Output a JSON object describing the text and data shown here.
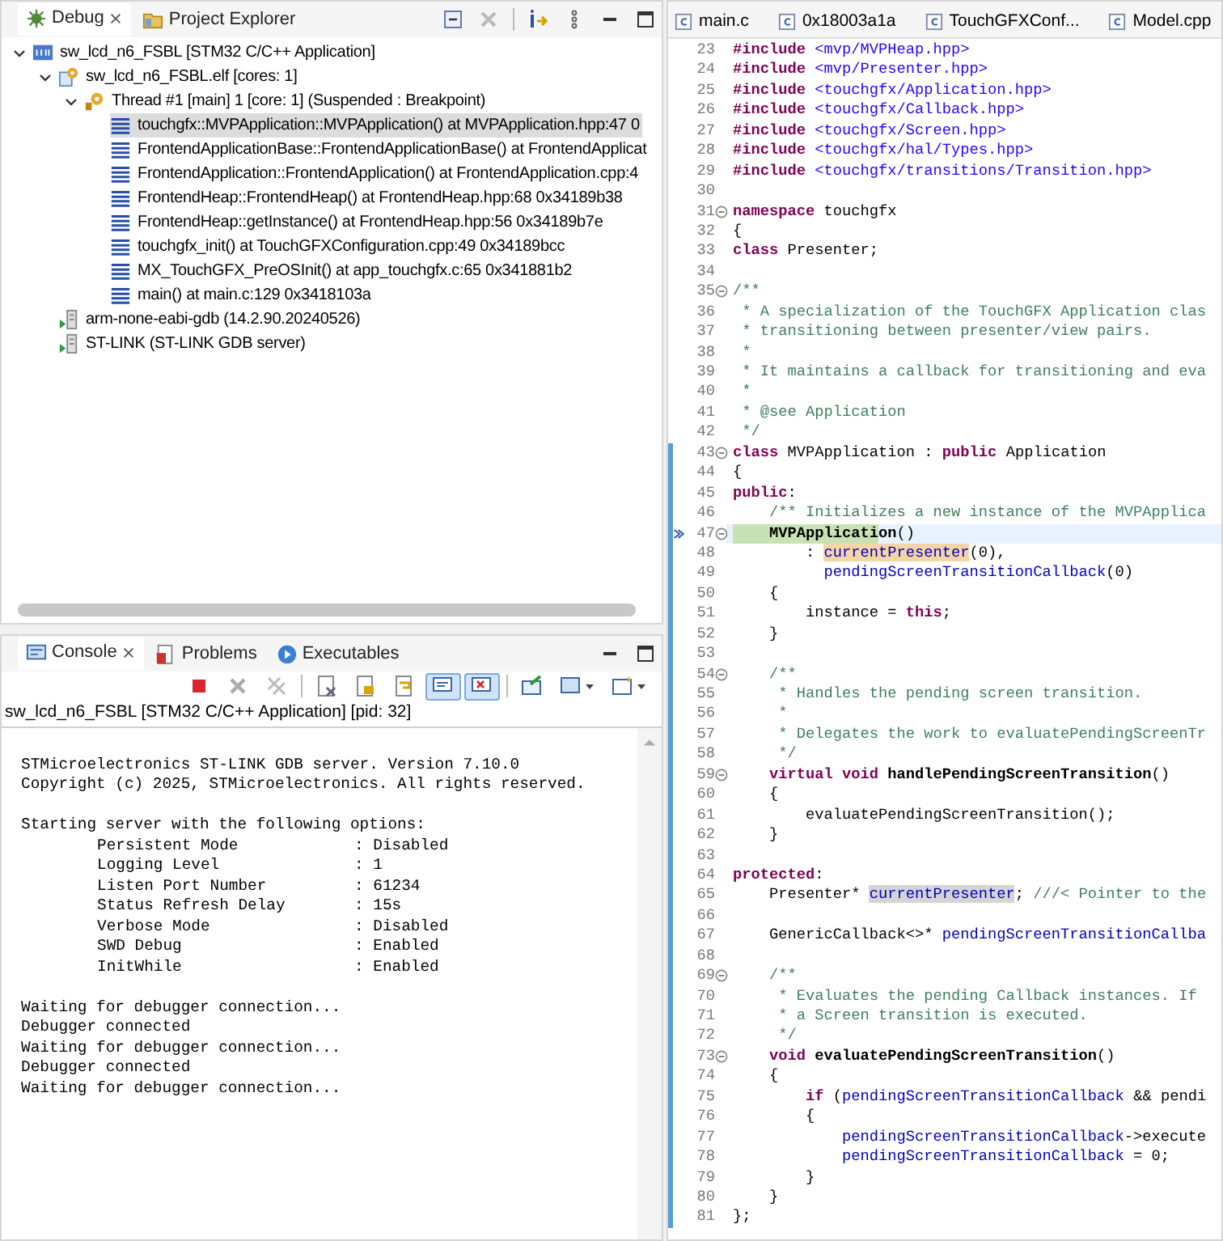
{
  "debug_view": {
    "tabs": [
      {
        "label": "Debug",
        "selected": true,
        "closable": true
      },
      {
        "label": "Project Explorer",
        "selected": false,
        "closable": false
      }
    ],
    "tree": [
      {
        "kind": "launch",
        "label": "sw_lcd_n6_FSBL [STM32 C/C++ Application]",
        "expanded": true,
        "selected": false,
        "children": [
          {
            "kind": "process",
            "label": "sw_lcd_n6_FSBL.elf [cores: 1]",
            "expanded": true,
            "selected": false,
            "children": [
              {
                "kind": "thread",
                "label": "Thread #1 [main] 1 [core: 1] (Suspended : Breakpoint)",
                "expanded": true,
                "selected": false,
                "children": [
                  {
                    "kind": "frame",
                    "label": "touchgfx::MVPApplication::MVPApplication() at MVPApplication.hpp:47 0",
                    "selected": true
                  },
                  {
                    "kind": "frame",
                    "label": "FrontendApplicationBase::FrontendApplicationBase() at FrontendApplicat",
                    "selected": false
                  },
                  {
                    "kind": "frame",
                    "label": "FrontendApplication::FrontendApplication() at FrontendApplication.cpp:4",
                    "selected": false
                  },
                  {
                    "kind": "frame",
                    "label": "FrontendHeap::FrontendHeap() at FrontendHeap.hpp:68 0x34189b38",
                    "selected": false
                  },
                  {
                    "kind": "frame",
                    "label": "FrontendHeap::getInstance() at FrontendHeap.hpp:56 0x34189b7e",
                    "selected": false
                  },
                  {
                    "kind": "frame",
                    "label": "touchgfx_init() at TouchGFXConfiguration.cpp:49 0x34189bcc",
                    "selected": false
                  },
                  {
                    "kind": "frame",
                    "label": "MX_TouchGFX_PreOSInit() at app_touchgfx.c:65 0x341881b2",
                    "selected": false
                  },
                  {
                    "kind": "frame",
                    "label": "main() at main.c:129 0x3418103a",
                    "selected": false
                  }
                ]
              }
            ]
          },
          {
            "kind": "debugger",
            "label": "arm-none-eabi-gdb (14.2.90.20240526)",
            "selected": false
          },
          {
            "kind": "debugger",
            "label": "ST-LINK (ST-LINK GDB server)",
            "selected": false
          }
        ]
      }
    ]
  },
  "console_view": {
    "tabs": [
      {
        "label": "Console",
        "selected": true,
        "closable": true,
        "kind": "console"
      },
      {
        "label": "Problems",
        "selected": false,
        "closable": false,
        "kind": "problems"
      },
      {
        "label": "Executables",
        "selected": false,
        "closable": false,
        "kind": "executables"
      }
    ],
    "toolbar": [
      {
        "kind": "terminate",
        "pressed": false
      },
      {
        "kind": "remove",
        "pressed": false
      },
      {
        "kind": "remove-all",
        "pressed": false
      },
      {
        "kind": "separator"
      },
      {
        "kind": "clear",
        "pressed": false
      },
      {
        "kind": "lock",
        "pressed": false
      },
      {
        "kind": "wrap",
        "pressed": false
      },
      {
        "kind": "show-out",
        "pressed": true
      },
      {
        "kind": "show-err",
        "pressed": true
      },
      {
        "kind": "separator"
      },
      {
        "kind": "pin",
        "pressed": false
      },
      {
        "kind": "display",
        "pressed": false
      },
      {
        "kind": "new",
        "pressed": false
      }
    ],
    "title": "sw_lcd_n6_FSBL [STM32 C/C++ Application]  [pid: 32]",
    "header": [
      "STMicroelectronics ST-LINK GDB server. Version 7.10.0",
      "Copyright (c) 2025, STMicroelectronics. All rights reserved."
    ],
    "intro": "Starting server with the following options:",
    "options": [
      {
        "name": "Persistent Mode",
        "value": ": Disabled"
      },
      {
        "name": "Logging Level",
        "value": ": 1"
      },
      {
        "name": "Listen Port Number",
        "value": ": 61234"
      },
      {
        "name": "Status Refresh Delay",
        "value": ": 15s"
      },
      {
        "name": "Verbose Mode",
        "value": ": Disabled"
      },
      {
        "name": "SWD Debug",
        "value": ": Enabled"
      },
      {
        "name": "InitWhile",
        "value": ": Enabled"
      }
    ],
    "log": [
      "Waiting for debugger connection...",
      "Debugger connected",
      "Waiting for debugger connection...",
      "Debugger connected",
      "Waiting for debugger connection..."
    ]
  },
  "editor": {
    "tabs": [
      {
        "label": "main.c",
        "selected": false
      },
      {
        "label": "0x18003a1a",
        "selected": false
      },
      {
        "label": "TouchGFXConf...",
        "selected": false
      },
      {
        "label": "Model.cpp",
        "selected": false
      }
    ],
    "lines": [
      {
        "num": "23",
        "fold": false,
        "current": false,
        "scope": false,
        "tokens": [
          {
            "kind": "kw",
            "text": "#include "
          },
          {
            "kind": "str",
            "text": "<mvp/MVPHeap.hpp>"
          }
        ]
      },
      {
        "num": "24",
        "fold": false,
        "current": false,
        "scope": false,
        "tokens": [
          {
            "kind": "kw",
            "text": "#include "
          },
          {
            "kind": "str",
            "text": "<mvp/Presenter.hpp>"
          }
        ]
      },
      {
        "num": "25",
        "fold": false,
        "current": false,
        "scope": false,
        "tokens": [
          {
            "kind": "kw",
            "text": "#include "
          },
          {
            "kind": "str",
            "text": "<touchgfx/Application.hpp>"
          }
        ]
      },
      {
        "num": "26",
        "fold": false,
        "current": false,
        "scope": false,
        "tokens": [
          {
            "kind": "kw",
            "text": "#include "
          },
          {
            "kind": "str",
            "text": "<touchgfx/Callback.hpp>"
          }
        ]
      },
      {
        "num": "27",
        "fold": false,
        "current": false,
        "scope": false,
        "tokens": [
          {
            "kind": "kw",
            "text": "#include "
          },
          {
            "kind": "str",
            "text": "<touchgfx/Screen.hpp>"
          }
        ]
      },
      {
        "num": "28",
        "fold": false,
        "current": false,
        "scope": false,
        "tokens": [
          {
            "kind": "kw",
            "text": "#include "
          },
          {
            "kind": "str",
            "text": "<touchgfx/hal/Types.hpp>"
          }
        ]
      },
      {
        "num": "29",
        "fold": false,
        "current": false,
        "scope": false,
        "tokens": [
          {
            "kind": "kw",
            "text": "#include "
          },
          {
            "kind": "str",
            "text": "<touchgfx/transitions/Transition.hpp>"
          }
        ]
      },
      {
        "num": "30",
        "fold": false,
        "current": false,
        "scope": false
      },
      {
        "num": "31",
        "fold": true,
        "current": false,
        "scope": false,
        "tokens": [
          {
            "kind": "kw",
            "text": "namespace"
          },
          {
            "kind": "txt",
            "text": " touchgfx"
          }
        ]
      },
      {
        "num": "32",
        "fold": false,
        "current": false,
        "scope": false,
        "tokens": [
          {
            "kind": "txt",
            "text": "{"
          }
        ]
      },
      {
        "num": "33",
        "fold": false,
        "current": false,
        "scope": false,
        "tokens": [
          {
            "kind": "kw",
            "text": "class"
          },
          {
            "kind": "txt",
            "text": " Presenter;"
          }
        ]
      },
      {
        "num": "34",
        "fold": false,
        "current": false,
        "scope": false
      },
      {
        "num": "35",
        "fold": true,
        "current": false,
        "scope": false,
        "tokens": [
          {
            "kind": "com",
            "text": "/**"
          }
        ]
      },
      {
        "num": "36",
        "fold": false,
        "current": false,
        "scope": false,
        "tokens": [
          {
            "kind": "com",
            "text": " * A specialization of the TouchGFX Application clas"
          }
        ]
      },
      {
        "num": "37",
        "fold": false,
        "current": false,
        "scope": false,
        "tokens": [
          {
            "kind": "com",
            "text": " * transitioning between presenter/view pairs."
          }
        ]
      },
      {
        "num": "38",
        "fold": false,
        "current": false,
        "scope": false,
        "tokens": [
          {
            "kind": "com",
            "text": " *"
          }
        ]
      },
      {
        "num": "39",
        "fold": false,
        "current": false,
        "scope": false,
        "tokens": [
          {
            "kind": "com",
            "text": " * It maintains a callback for transitioning and eva"
          }
        ]
      },
      {
        "num": "40",
        "fold": false,
        "current": false,
        "scope": false,
        "tokens": [
          {
            "kind": "com",
            "text": " *"
          }
        ]
      },
      {
        "num": "41",
        "fold": false,
        "current": false,
        "scope": false,
        "tokens": [
          {
            "kind": "com",
            "text": " * @see Application"
          }
        ]
      },
      {
        "num": "42",
        "fold": false,
        "current": false,
        "scope": false,
        "tokens": [
          {
            "kind": "com",
            "text": " */"
          }
        ]
      },
      {
        "num": "43",
        "fold": true,
        "current": false,
        "scope": true,
        "tokens": [
          {
            "kind": "kw",
            "text": "class"
          },
          {
            "kind": "txt",
            "text": " MVPApplication : "
          },
          {
            "kind": "kw",
            "text": "public"
          },
          {
            "kind": "txt",
            "text": " Application"
          }
        ]
      },
      {
        "num": "44",
        "fold": false,
        "current": false,
        "scope": true,
        "tokens": [
          {
            "kind": "txt",
            "text": "{"
          }
        ]
      },
      {
        "num": "45",
        "fold": false,
        "current": false,
        "scope": true,
        "tokens": [
          {
            "kind": "kw",
            "text": "public"
          },
          {
            "kind": "txt",
            "text": ":"
          }
        ]
      },
      {
        "num": "46",
        "fold": false,
        "current": false,
        "scope": true,
        "tokens": [
          {
            "kind": "com",
            "text": "    /** Initializes a new instance of the MVPApplica"
          }
        ]
      },
      {
        "num": "47",
        "fold": true,
        "current": true,
        "scope": true,
        "tokens": [
          {
            "kind": "fn",
            "text": "    MVPApplication"
          },
          {
            "kind": "txt",
            "text": "()"
          }
        ]
      },
      {
        "num": "48",
        "fold": false,
        "current": false,
        "scope": true,
        "tokens": [
          {
            "kind": "txt",
            "text": "        : "
          },
          {
            "kind": "write",
            "text": "currentPresenter"
          },
          {
            "kind": "txt",
            "text": "(0),"
          }
        ]
      },
      {
        "num": "49",
        "fold": false,
        "current": false,
        "scope": true,
        "tokens": [
          {
            "kind": "field",
            "text": "          pendingScreenTransitionCallback"
          },
          {
            "kind": "txt",
            "text": "(0)"
          }
        ]
      },
      {
        "num": "50",
        "fold": false,
        "current": false,
        "scope": true,
        "tokens": [
          {
            "kind": "txt",
            "text": "    {"
          }
        ]
      },
      {
        "num": "51",
        "fold": false,
        "current": false,
        "scope": true,
        "tokens": [
          {
            "kind": "txt",
            "text": "        instance = "
          },
          {
            "kind": "kw",
            "text": "this"
          },
          {
            "kind": "txt",
            "text": ";"
          }
        ]
      },
      {
        "num": "52",
        "fold": false,
        "current": false,
        "scope": true,
        "tokens": [
          {
            "kind": "txt",
            "text": "    }"
          }
        ]
      },
      {
        "num": "53",
        "fold": false,
        "current": false,
        "scope": true
      },
      {
        "num": "54",
        "fold": true,
        "current": false,
        "scope": true,
        "tokens": [
          {
            "kind": "com",
            "text": "    /**"
          }
        ]
      },
      {
        "num": "55",
        "fold": false,
        "current": false,
        "scope": true,
        "tokens": [
          {
            "kind": "com",
            "text": "     * Handles the pending screen transition."
          }
        ]
      },
      {
        "num": "56",
        "fold": false,
        "current": false,
        "scope": true,
        "tokens": [
          {
            "kind": "com",
            "text": "     *"
          }
        ]
      },
      {
        "num": "57",
        "fold": false,
        "current": false,
        "scope": true,
        "tokens": [
          {
            "kind": "com",
            "text": "     * Delegates the work to evaluatePendingScreenTr"
          }
        ]
      },
      {
        "num": "58",
        "fold": false,
        "current": false,
        "scope": true,
        "tokens": [
          {
            "kind": "com",
            "text": "     */"
          }
        ]
      },
      {
        "num": "59",
        "fold": true,
        "current": false,
        "scope": true,
        "tokens": [
          {
            "kind": "kw",
            "text": "    virtual void "
          },
          {
            "kind": "fn",
            "text": "handlePendingScreenTransition"
          },
          {
            "kind": "txt",
            "text": "()"
          }
        ]
      },
      {
        "num": "60",
        "fold": false,
        "current": false,
        "scope": true,
        "tokens": [
          {
            "kind": "txt",
            "text": "    {"
          }
        ]
      },
      {
        "num": "61",
        "fold": false,
        "current": false,
        "scope": true,
        "tokens": [
          {
            "kind": "txt",
            "text": "        evaluatePendingScreenTransition();"
          }
        ]
      },
      {
        "num": "62",
        "fold": false,
        "current": false,
        "scope": true,
        "tokens": [
          {
            "kind": "txt",
            "text": "    }"
          }
        ]
      },
      {
        "num": "63",
        "fold": false,
        "current": false,
        "scope": true
      },
      {
        "num": "64",
        "fold": false,
        "current": false,
        "scope": true,
        "tokens": [
          {
            "kind": "kw",
            "text": "protected"
          },
          {
            "kind": "txt",
            "text": ":"
          }
        ]
      },
      {
        "num": "65",
        "fold": false,
        "current": false,
        "scope": true,
        "tokens": [
          {
            "kind": "txt",
            "text": "    Presenter* "
          },
          {
            "kind": "occ",
            "text": "currentPresenter"
          },
          {
            "kind": "txt",
            "text": "; "
          },
          {
            "kind": "com",
            "text": "///< Pointer to the"
          }
        ]
      },
      {
        "num": "66",
        "fold": false,
        "current": false,
        "scope": true
      },
      {
        "num": "67",
        "fold": false,
        "current": false,
        "scope": true,
        "tokens": [
          {
            "kind": "txt",
            "text": "    GenericCallback<>* "
          },
          {
            "kind": "field",
            "text": "pendingScreenTransitionCallba"
          }
        ]
      },
      {
        "num": "68",
        "fold": false,
        "current": false,
        "scope": true
      },
      {
        "num": "69",
        "fold": true,
        "current": false,
        "scope": true,
        "tokens": [
          {
            "kind": "com",
            "text": "    /**"
          }
        ]
      },
      {
        "num": "70",
        "fold": false,
        "current": false,
        "scope": true,
        "tokens": [
          {
            "kind": "com",
            "text": "     * Evaluates the pending Callback instances. If"
          }
        ]
      },
      {
        "num": "71",
        "fold": false,
        "current": false,
        "scope": true,
        "tokens": [
          {
            "kind": "com",
            "text": "     * a Screen transition is executed."
          }
        ]
      },
      {
        "num": "72",
        "fold": false,
        "current": false,
        "scope": true,
        "tokens": [
          {
            "kind": "com",
            "text": "     */"
          }
        ]
      },
      {
        "num": "73",
        "fold": true,
        "current": false,
        "scope": true,
        "tokens": [
          {
            "kind": "kw",
            "text": "    void "
          },
          {
            "kind": "fn",
            "text": "evaluatePendingScreenTransition"
          },
          {
            "kind": "txt",
            "text": "()"
          }
        ]
      },
      {
        "num": "74",
        "fold": false,
        "current": false,
        "scope": true,
        "tokens": [
          {
            "kind": "txt",
            "text": "    {"
          }
        ]
      },
      {
        "num": "75",
        "fold": false,
        "current": false,
        "scope": true,
        "tokens": [
          {
            "kind": "kw",
            "text": "        if"
          },
          {
            "kind": "txt",
            "text": " ("
          },
          {
            "kind": "field",
            "text": "pendingScreenTransitionCallback"
          },
          {
            "kind": "txt",
            "text": " && pendi"
          }
        ]
      },
      {
        "num": "76",
        "fold": false,
        "current": false,
        "scope": true,
        "tokens": [
          {
            "kind": "txt",
            "text": "        {"
          }
        ]
      },
      {
        "num": "77",
        "fold": false,
        "current": false,
        "scope": true,
        "tokens": [
          {
            "kind": "field",
            "text": "            pendingScreenTransitionCallback"
          },
          {
            "kind": "txt",
            "text": "->execute"
          }
        ]
      },
      {
        "num": "78",
        "fold": false,
        "current": false,
        "scope": true,
        "tokens": [
          {
            "kind": "field",
            "text": "            pendingScreenTransitionCallback"
          },
          {
            "kind": "txt",
            "text": " = 0;"
          }
        ]
      },
      {
        "num": "79",
        "fold": false,
        "current": false,
        "scope": true,
        "tokens": [
          {
            "kind": "txt",
            "text": "        }"
          }
        ]
      },
      {
        "num": "80",
        "fold": false,
        "current": false,
        "scope": true,
        "tokens": [
          {
            "kind": "txt",
            "text": "    }"
          }
        ]
      },
      {
        "num": "81",
        "fold": false,
        "current": false,
        "scope": true,
        "tokens": [
          {
            "kind": "txt",
            "text": "};"
          }
        ]
      }
    ]
  }
}
